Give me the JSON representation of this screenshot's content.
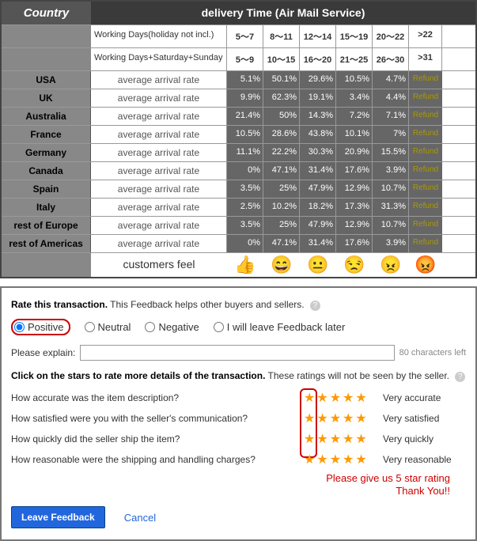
{
  "header": {
    "country": "Country",
    "delivery": "delivery Time (Air Mail Service)"
  },
  "wd1": {
    "label": "Working Days(holiday not incl.)",
    "r": [
      "5～7",
      "8～11",
      "12～14",
      "15～19",
      "20～22",
      ">22"
    ]
  },
  "wd2": {
    "label": "Working Days+Saturday+Sunday",
    "r": [
      "5～9",
      "10～15",
      "16～20",
      "21～25",
      "26～30",
      ">31"
    ]
  },
  "rows": [
    {
      "c": "USA",
      "l": "average arrival rate",
      "v": [
        "5.1%",
        "50.1%",
        "29.6%",
        "10.5%",
        "4.7%"
      ],
      "rf": "Refund"
    },
    {
      "c": "UK",
      "l": "average arrival rate",
      "v": [
        "9.9%",
        "62.3%",
        "19.1%",
        "3.4%",
        "4.4%"
      ],
      "rf": "Refund"
    },
    {
      "c": "Australia",
      "l": "average arrival rate",
      "v": [
        "21.4%",
        "50%",
        "14.3%",
        "7.2%",
        "7.1%"
      ],
      "rf": "Refund"
    },
    {
      "c": "France",
      "l": "average arrival rate",
      "v": [
        "10.5%",
        "28.6%",
        "43.8%",
        "10.1%",
        "7%"
      ],
      "rf": "Refund"
    },
    {
      "c": "Germany",
      "l": "average arrival rate",
      "v": [
        "11.1%",
        "22.2%",
        "30.3%",
        "20.9%",
        "15.5%"
      ],
      "rf": "Refund"
    },
    {
      "c": "Canada",
      "l": "average arrival rate",
      "v": [
        "0%",
        "47.1%",
        "31.4%",
        "17.6%",
        "3.9%"
      ],
      "rf": "Refund"
    },
    {
      "c": "Spain",
      "l": "average arrival rate",
      "v": [
        "3.5%",
        "25%",
        "47.9%",
        "12.9%",
        "10.7%"
      ],
      "rf": "Refund"
    },
    {
      "c": "Italy",
      "l": "average arrival rate",
      "v": [
        "2.5%",
        "10.2%",
        "18.2%",
        "17.3%",
        "31.3%"
      ],
      "rf": "Refund"
    },
    {
      "c": "rest of Europe",
      "l": "average arrival rate",
      "v": [
        "3.5%",
        "25%",
        "47.9%",
        "12.9%",
        "10.7%"
      ],
      "rf": "Refund"
    },
    {
      "c": "rest of Americas",
      "l": "average arrival rate",
      "v": [
        "0%",
        "47.1%",
        "31.4%",
        "17.6%",
        "3.9%"
      ],
      "rf": "Refund"
    }
  ],
  "feel": {
    "label": "customers feel",
    "emojis": [
      "👍",
      "😄",
      "😐",
      "😒",
      "😠",
      "😡"
    ]
  },
  "fb": {
    "title_b": "Rate this transaction.",
    "title_r": " This Feedback helps other buyers and sellers.",
    "opts": [
      "Positive",
      "Neutral",
      "Negative",
      "I will leave Feedback later"
    ],
    "explain": "Please explain:",
    "chars": "80 characters left",
    "stars_b": "Click on the stars to rate more details of the transaction.",
    "stars_r": " These ratings will not be seen by the seller.",
    "qs": [
      {
        "q": "How accurate was the item description?",
        "l": "Very accurate"
      },
      {
        "q": "How satisfied were you with the seller's communication?",
        "l": "Very satisfied"
      },
      {
        "q": "How quickly did the seller ship the item?",
        "l": "Very quickly"
      },
      {
        "q": "How reasonable were the shipping and handling charges?",
        "l": "Very reasonable"
      }
    ],
    "plea1": "Please give us 5 star rating",
    "plea2": "Thank You!!",
    "leave": "Leave Feedback",
    "cancel": "Cancel"
  },
  "star": "★★★★★"
}
